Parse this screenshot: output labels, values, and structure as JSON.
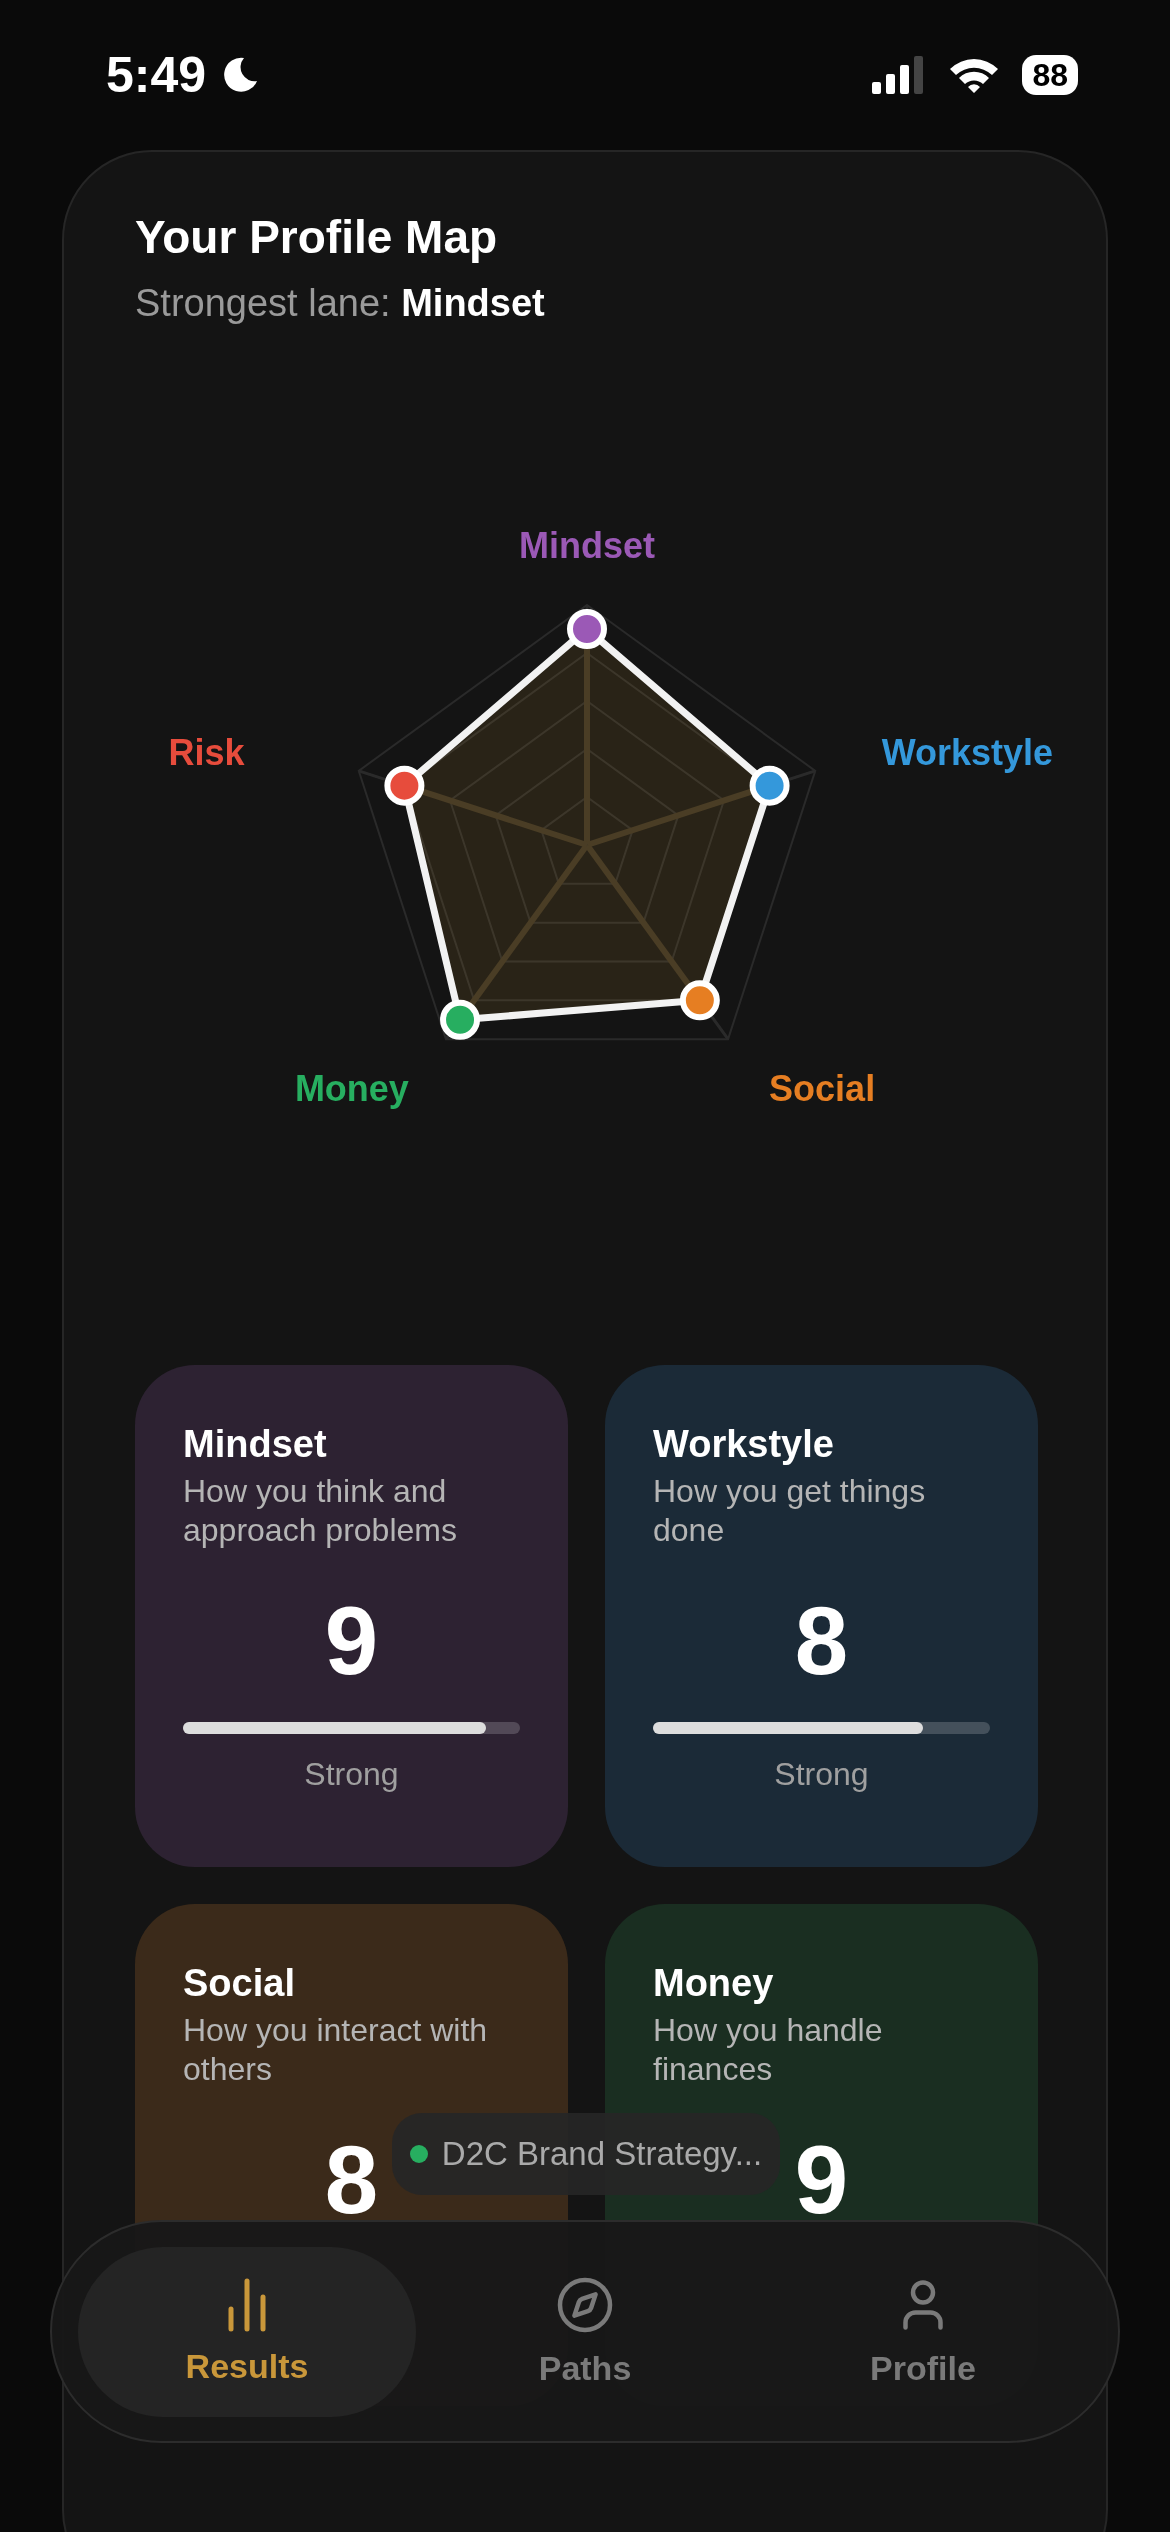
{
  "status_bar": {
    "time": "5:49",
    "battery": "88"
  },
  "profile_map": {
    "title": "Your Profile Map",
    "subtitle": "Strongest lane: **Mindset**",
    "radar": {
      "axes": [
        {
          "label": "Mindset",
          "color": "#9b59b6",
          "level": 0.9
        },
        {
          "label": "Workstyle",
          "color": "#3498db",
          "level": 0.8
        },
        {
          "label": "Social",
          "color": "#e67e22",
          "level": 0.8
        },
        {
          "label": "Money",
          "color": "#27ae60",
          "level": 0.9
        },
        {
          "label": "Risk",
          "color": "#e74c3c",
          "level": 0.8
        }
      ]
    },
    "cards": [
      {
        "title": "Mindset",
        "description": "How you think and approach problems",
        "score": "9",
        "level": 0.9,
        "rating": "Strong",
        "color": "#2d2232"
      },
      {
        "title": "Workstyle",
        "description": "How you get things done",
        "score": "8",
        "level": 0.8,
        "rating": "Strong",
        "color": "#1b2a37"
      },
      {
        "title": "Social",
        "description": "How you interact with others",
        "score": "8",
        "color": "#3b2a1a"
      },
      {
        "title": "Money",
        "description": "How you handle finances",
        "score": "9",
        "color": "#1a2e21"
      }
    ]
  },
  "toast": {
    "text": "D2C Brand Strategy...",
    "color": "#27ae60"
  },
  "tab_bar": [
    {
      "label": "Results",
      "selected": true
    },
    {
      "label": "Paths",
      "selected": false
    },
    {
      "label": "Profile",
      "selected": false
    }
  ]
}
